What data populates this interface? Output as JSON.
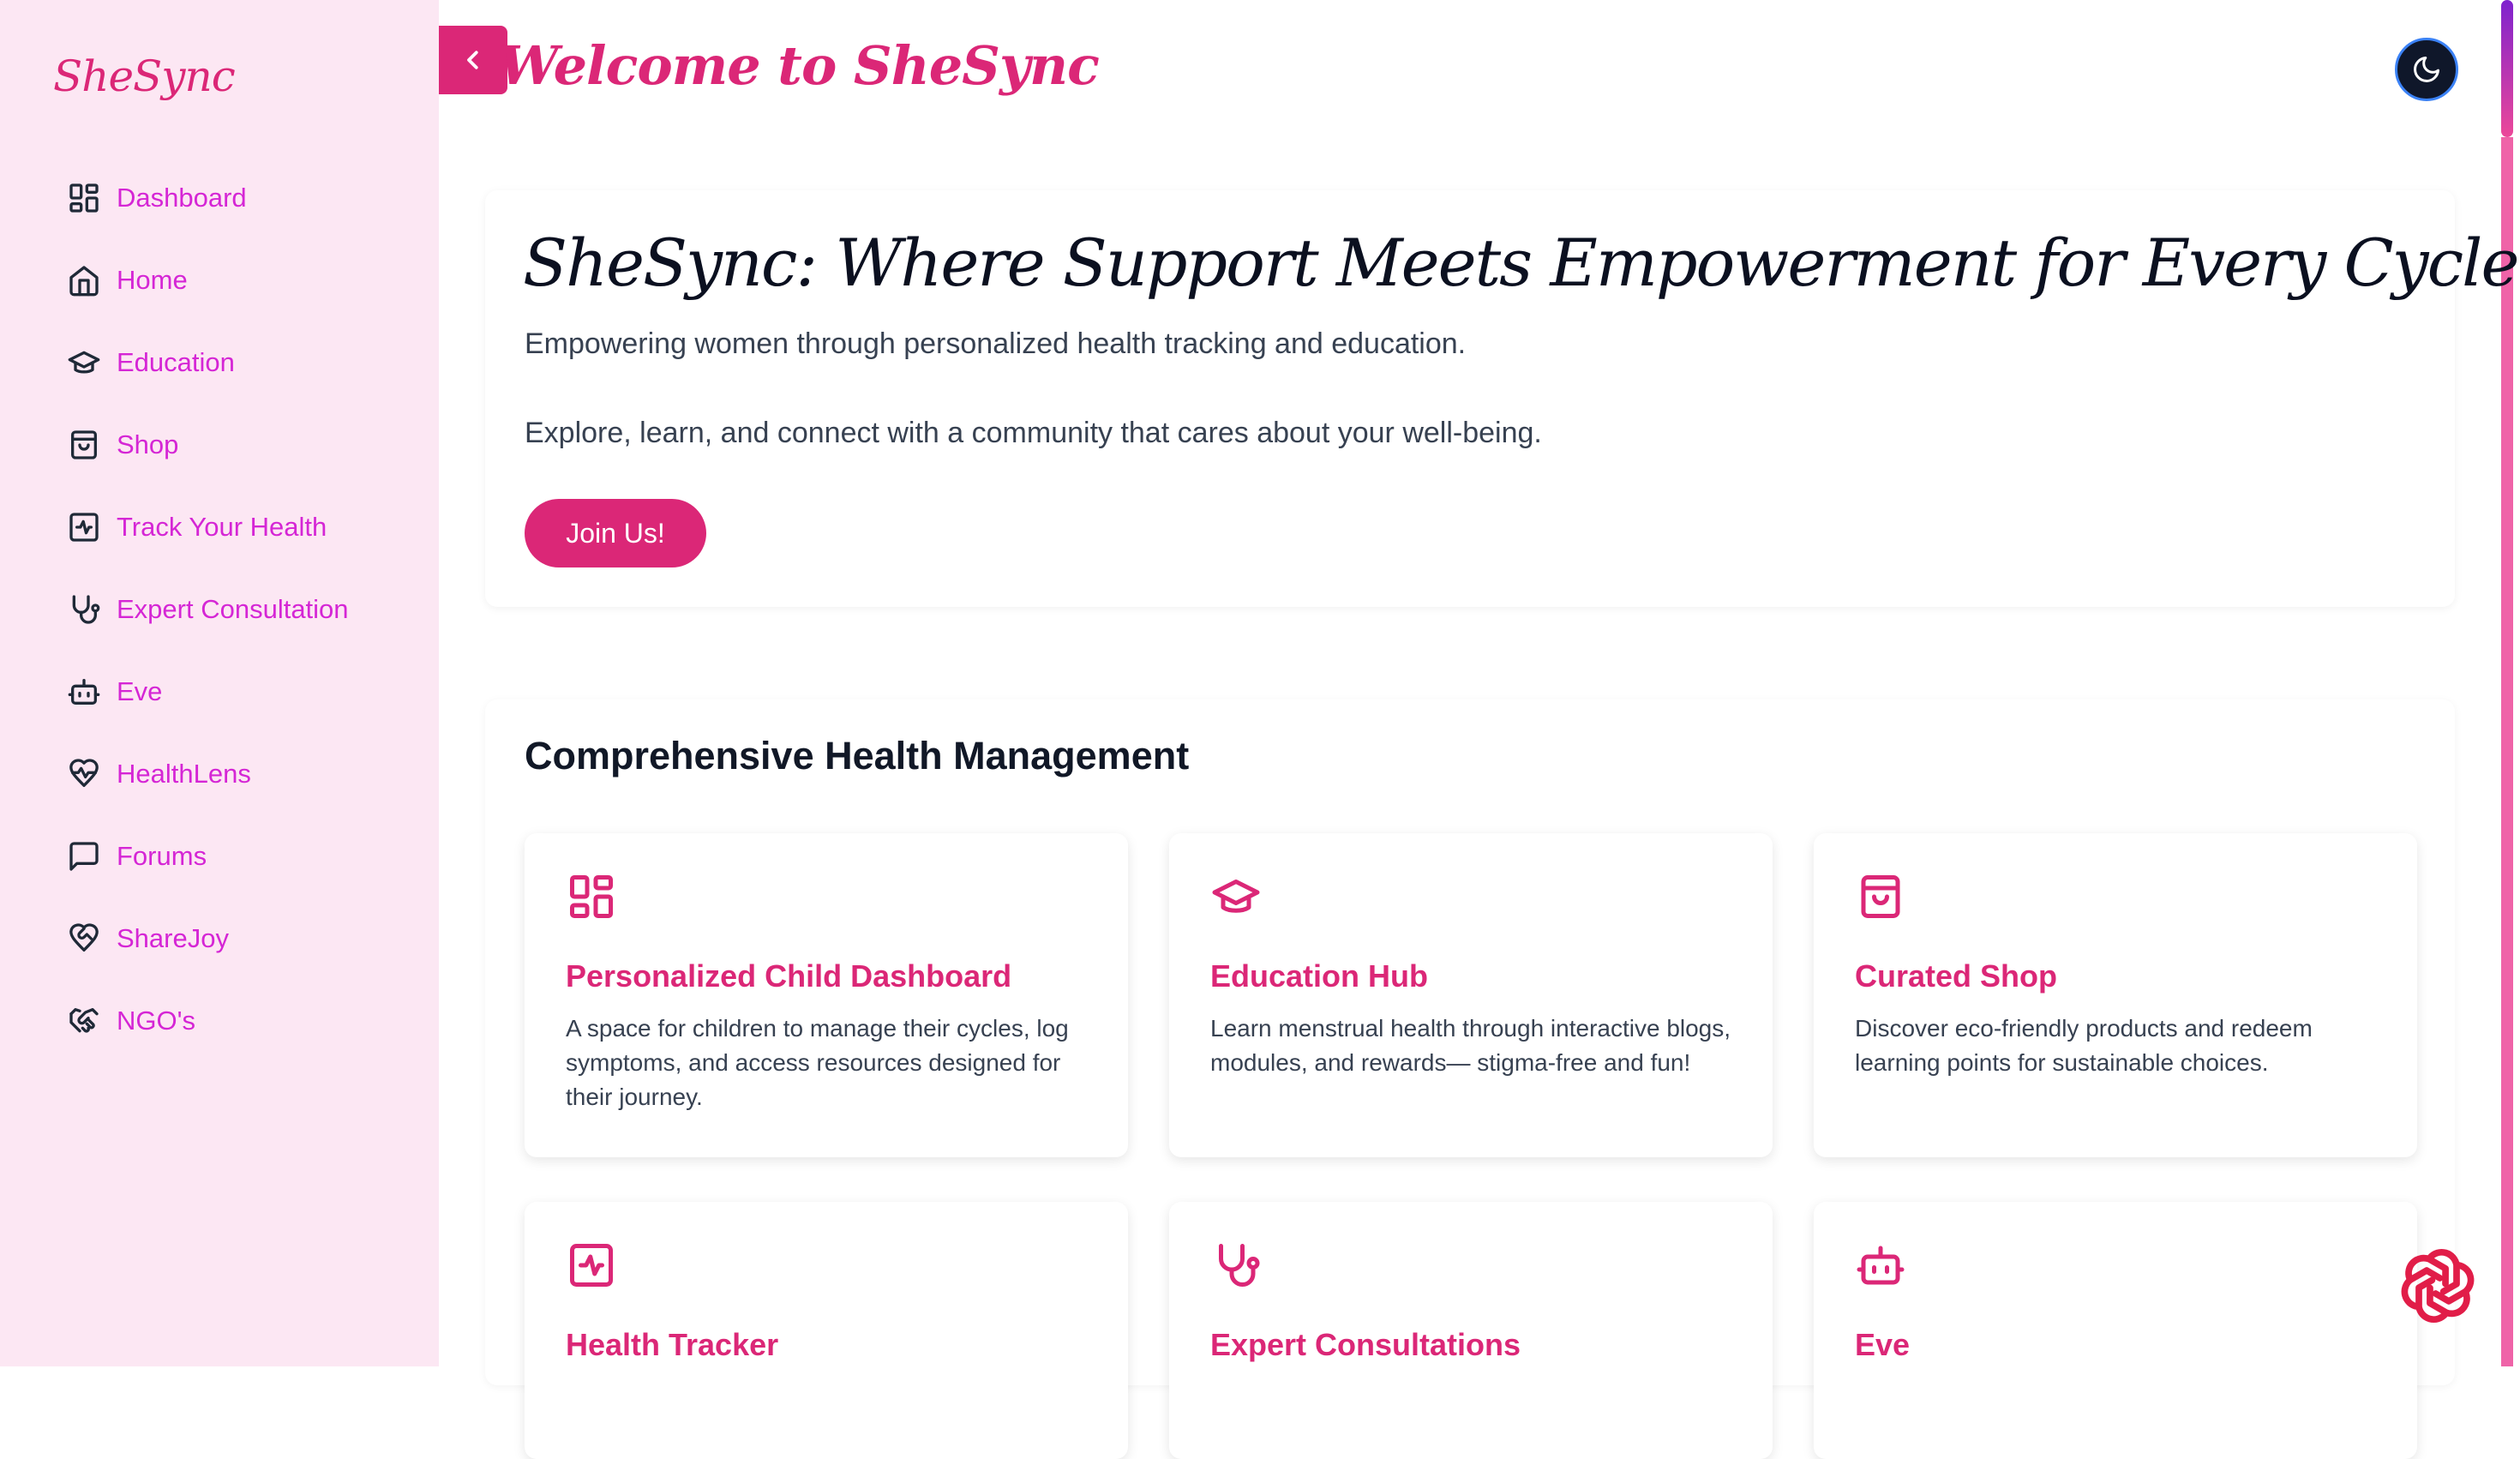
{
  "sidebar": {
    "brand": "SheSync",
    "items": [
      {
        "label": "Dashboard",
        "icon": "dashboard-grid-icon"
      },
      {
        "label": "Home",
        "icon": "home-icon"
      },
      {
        "label": "Education",
        "icon": "graduation-cap-icon"
      },
      {
        "label": "Shop",
        "icon": "shopping-bag-icon"
      },
      {
        "label": "Track Your Health",
        "icon": "activity-icon"
      },
      {
        "label": "Expert Consultation",
        "icon": "stethoscope-icon"
      },
      {
        "label": "Eve",
        "icon": "robot-icon"
      },
      {
        "label": "HealthLens",
        "icon": "heart-pulse-icon"
      },
      {
        "label": "Forums",
        "icon": "message-square-icon"
      },
      {
        "label": "ShareJoy",
        "icon": "heart-handshake-icon"
      },
      {
        "label": "NGO's",
        "icon": "handshake-icon"
      }
    ]
  },
  "header": {
    "title": "Welcome to SheSync"
  },
  "hero": {
    "title": "SheSync: Where Support Meets Empowerment for Every Cycle.",
    "line1": "Empowering women through personalized health tracking and education.",
    "line2": "Explore, learn, and connect with a community that cares about your well-being.",
    "cta": "Join Us!"
  },
  "features": {
    "title": "Comprehensive Health Management",
    "cards": [
      {
        "title": "Personalized Child Dashboard",
        "desc": "A space for children to manage their cycles, log symptoms, and access resources designed for their journey.",
        "icon": "dashboard-grid-icon"
      },
      {
        "title": "Education Hub",
        "desc": "Learn menstrual health through interactive blogs, modules, and rewards— stigma-free and fun!",
        "icon": "graduation-cap-icon"
      },
      {
        "title": "Curated Shop",
        "desc": "Discover eco-friendly products and redeem learning points for sustainable choices.",
        "icon": "shopping-bag-icon"
      },
      {
        "title": "Health Tracker",
        "desc": "",
        "icon": "activity-icon"
      },
      {
        "title": "Expert Consultations",
        "desc": "",
        "icon": "stethoscope-icon"
      },
      {
        "title": "Eve",
        "desc": "",
        "icon": "robot-icon"
      }
    ]
  },
  "colors": {
    "accent": "#db2777",
    "nav_text": "#d526d5",
    "sidebar_bg": "#fce7f3"
  }
}
